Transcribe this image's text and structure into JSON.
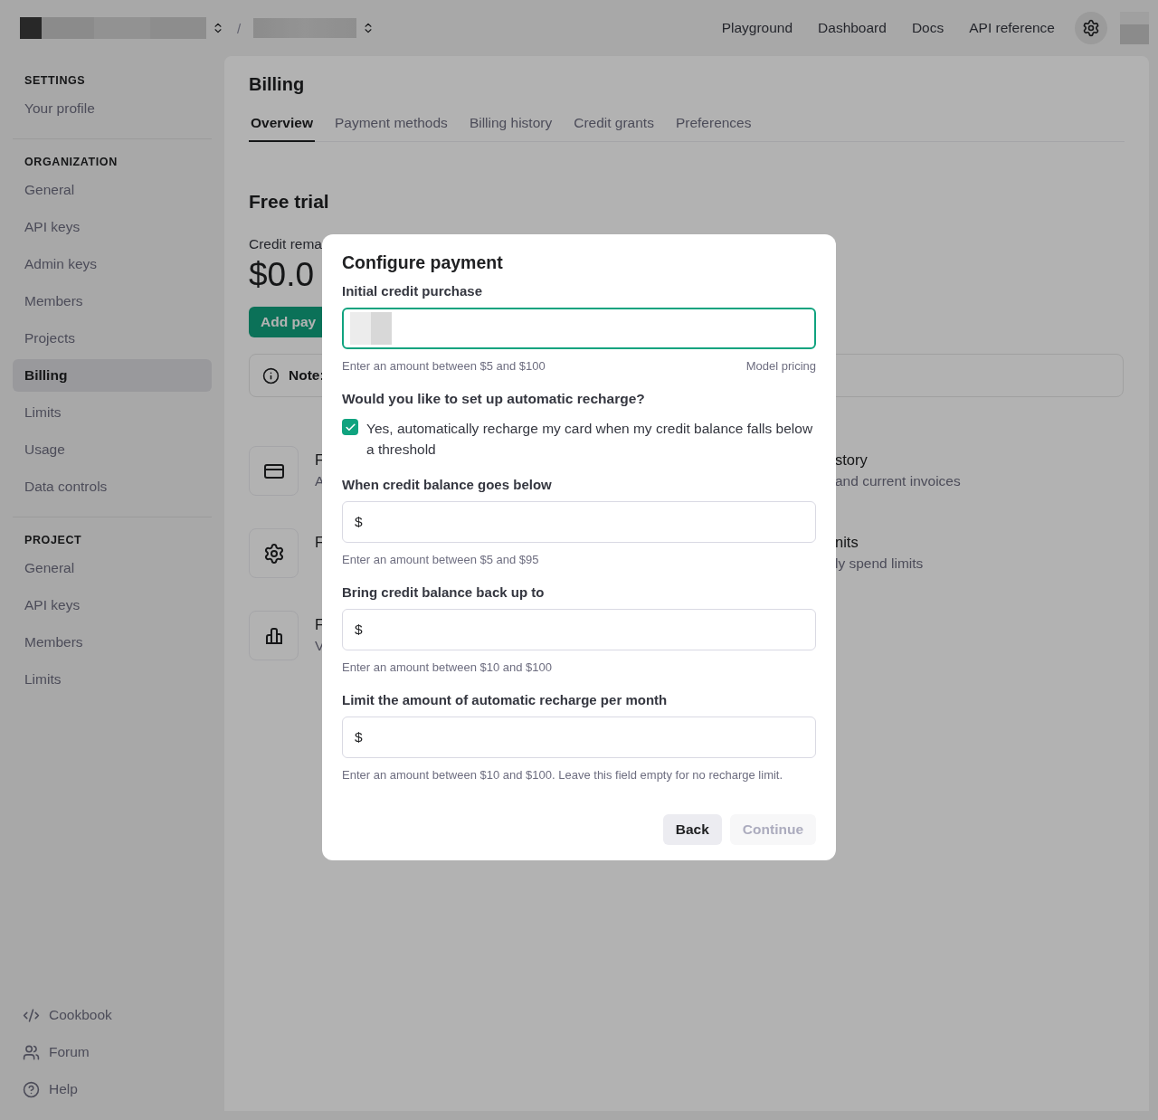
{
  "topbar": {
    "separator": "/",
    "nav": [
      "Playground",
      "Dashboard",
      "Docs",
      "API reference"
    ]
  },
  "sidebar": {
    "sections": [
      {
        "heading": "SETTINGS",
        "items": [
          {
            "label": "Your profile",
            "selected": false
          }
        ]
      },
      {
        "heading": "ORGANIZATION",
        "items": [
          {
            "label": "General",
            "selected": false
          },
          {
            "label": "API keys",
            "selected": false
          },
          {
            "label": "Admin keys",
            "selected": false
          },
          {
            "label": "Members",
            "selected": false
          },
          {
            "label": "Projects",
            "selected": false
          },
          {
            "label": "Billing",
            "selected": true
          },
          {
            "label": "Limits",
            "selected": false
          },
          {
            "label": "Usage",
            "selected": false
          },
          {
            "label": "Data controls",
            "selected": false
          }
        ]
      },
      {
        "heading": "PROJECT",
        "items": [
          {
            "label": "General",
            "selected": false
          },
          {
            "label": "API keys",
            "selected": false
          },
          {
            "label": "Members",
            "selected": false
          },
          {
            "label": "Limits",
            "selected": false
          }
        ]
      }
    ],
    "footer": [
      {
        "label": "Cookbook",
        "kind": "code"
      },
      {
        "label": "Forum",
        "kind": "people"
      },
      {
        "label": "Help",
        "kind": "help"
      }
    ]
  },
  "page": {
    "title": "Billing",
    "tabs": [
      {
        "label": "Overview",
        "selected": true
      },
      {
        "label": "Payment methods",
        "selected": false
      },
      {
        "label": "Billing history",
        "selected": false
      },
      {
        "label": "Credit grants",
        "selected": false
      },
      {
        "label": "Preferences",
        "selected": false
      }
    ]
  },
  "trial": {
    "title": "Free trial",
    "credit_label": "Credit rema",
    "amount": "$0.0",
    "add_button": "Add pay",
    "note": "Note:"
  },
  "cards_left": [
    {
      "kind": "card",
      "title": "F",
      "subtitle": "A"
    },
    {
      "kind": "gear",
      "title": "F"
    },
    {
      "kind": "chart",
      "title": "F",
      "subtitle": "V"
    }
  ],
  "cards_right": [
    {
      "title": "story",
      "subtitle": "and current invoices"
    },
    {
      "title": "nits",
      "subtitle": "ly spend limits"
    }
  ],
  "modal": {
    "title": "Configure payment",
    "initial": {
      "label": "Initial credit purchase",
      "focused": true,
      "hint": "Enter an amount between $5 and $100",
      "link": "Model pricing"
    },
    "question": "Would you like to set up automatic recharge?",
    "auto_recharge": {
      "checked": true,
      "label": "Yes, automatically recharge my card when my credit balance falls below a threshold"
    },
    "fields": [
      {
        "label": "When credit balance goes below",
        "prefix": "$",
        "hint": "Enter an amount between $5 and $95"
      },
      {
        "label": "Bring credit balance back up to",
        "prefix": "$",
        "hint": "Enter an amount between $10 and $100"
      },
      {
        "label": "Limit the amount of automatic recharge per month",
        "prefix": "$",
        "hint": "Enter an amount between $10 and $100. Leave this field empty for no recharge limit."
      }
    ],
    "buttons": [
      {
        "label": "Back",
        "disabled": false
      },
      {
        "label": "Continue",
        "disabled": true
      }
    ]
  }
}
